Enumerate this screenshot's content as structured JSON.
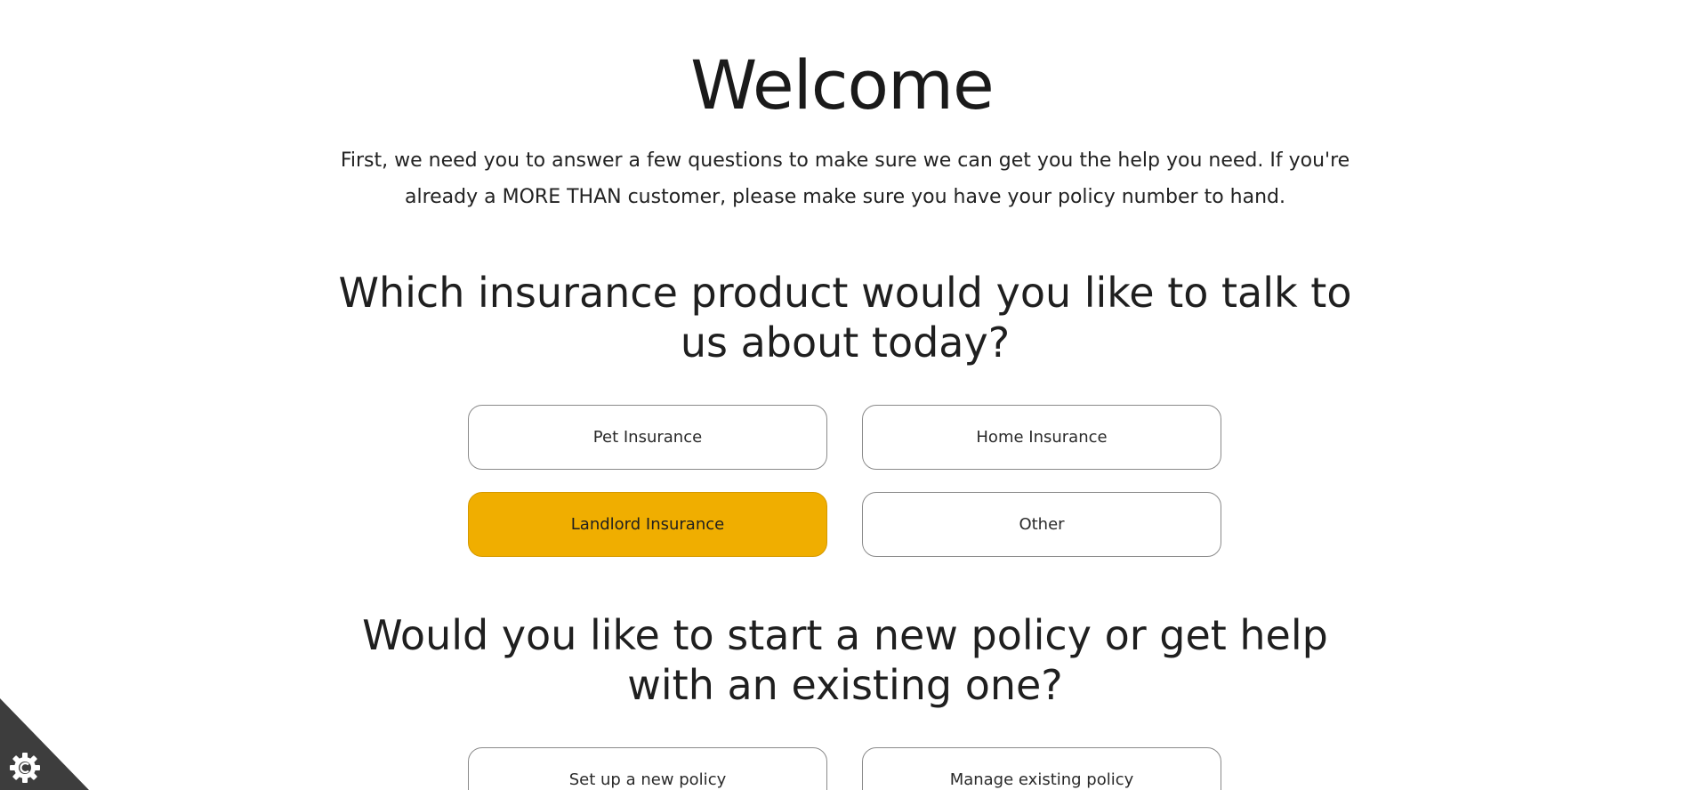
{
  "header": {
    "title": "Welcome",
    "intro": "First, we need you to answer a few questions to make sure we can get you the help you need. If you're already a MORE THAN customer, please make sure you have your policy number to hand."
  },
  "product_question": {
    "heading": "Which insurance product would you like to talk to us about today?",
    "options": [
      {
        "label": "Pet Insurance",
        "selected": false
      },
      {
        "label": "Home Insurance",
        "selected": false
      },
      {
        "label": "Landlord Insurance",
        "selected": true
      },
      {
        "label": "Other",
        "selected": false
      }
    ]
  },
  "policy_question": {
    "heading": "Would you like to start a new policy or get help with an existing one?",
    "options": [
      {
        "label": "Set up a new policy"
      },
      {
        "label": "Manage existing policy"
      }
    ]
  },
  "cookie_settings": {
    "icon": "cookie-gear-icon"
  },
  "colors": {
    "accent": "#f0ae00",
    "border": "#8a8a8a",
    "cookie_corner": "#3d3d3d"
  }
}
